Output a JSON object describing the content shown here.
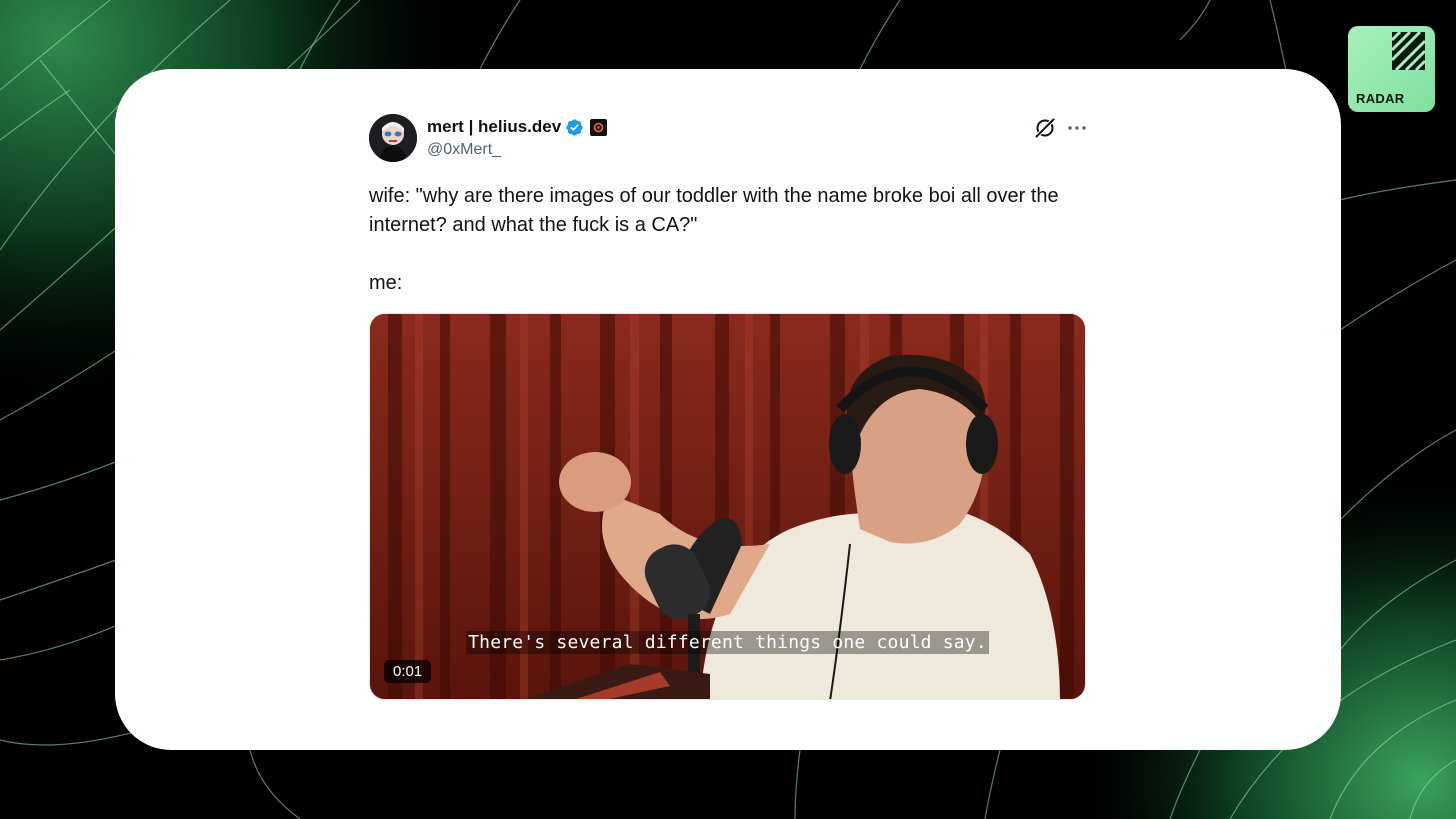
{
  "tweet": {
    "display_name": "mert | helius.dev",
    "handle": "@0xMert_",
    "verified": true,
    "text_line1": "wife: \"why are there images of our toddler with the name broke boi all over the internet? and what the fuck is a CA?\"",
    "text_line2": "me:",
    "media": {
      "subtitle": "There's several different things one could say.",
      "timestamp": "0:01"
    },
    "icons": {
      "verified": "verified-badge-icon",
      "affiliate": "affiliate-badge-icon",
      "grok": "grok-icon",
      "more": "more-icon"
    }
  },
  "brand": {
    "logo_text": "RADAR",
    "accent_color": "#7fe09f"
  },
  "colors": {
    "background": "#000000",
    "card": "#ffffff",
    "verified": "#1d9bf0",
    "handle": "#536471",
    "text": "#0f1419"
  }
}
